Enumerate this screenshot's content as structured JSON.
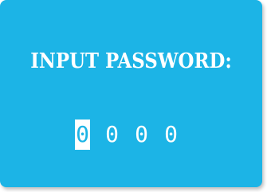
{
  "prompt_label": "INPUT PASSWORD:",
  "password": {
    "digits": [
      "0",
      "0",
      "0",
      "0"
    ],
    "active_index": 0
  },
  "colors": {
    "panel": "#1cb4e6",
    "text": "#ffffff"
  }
}
